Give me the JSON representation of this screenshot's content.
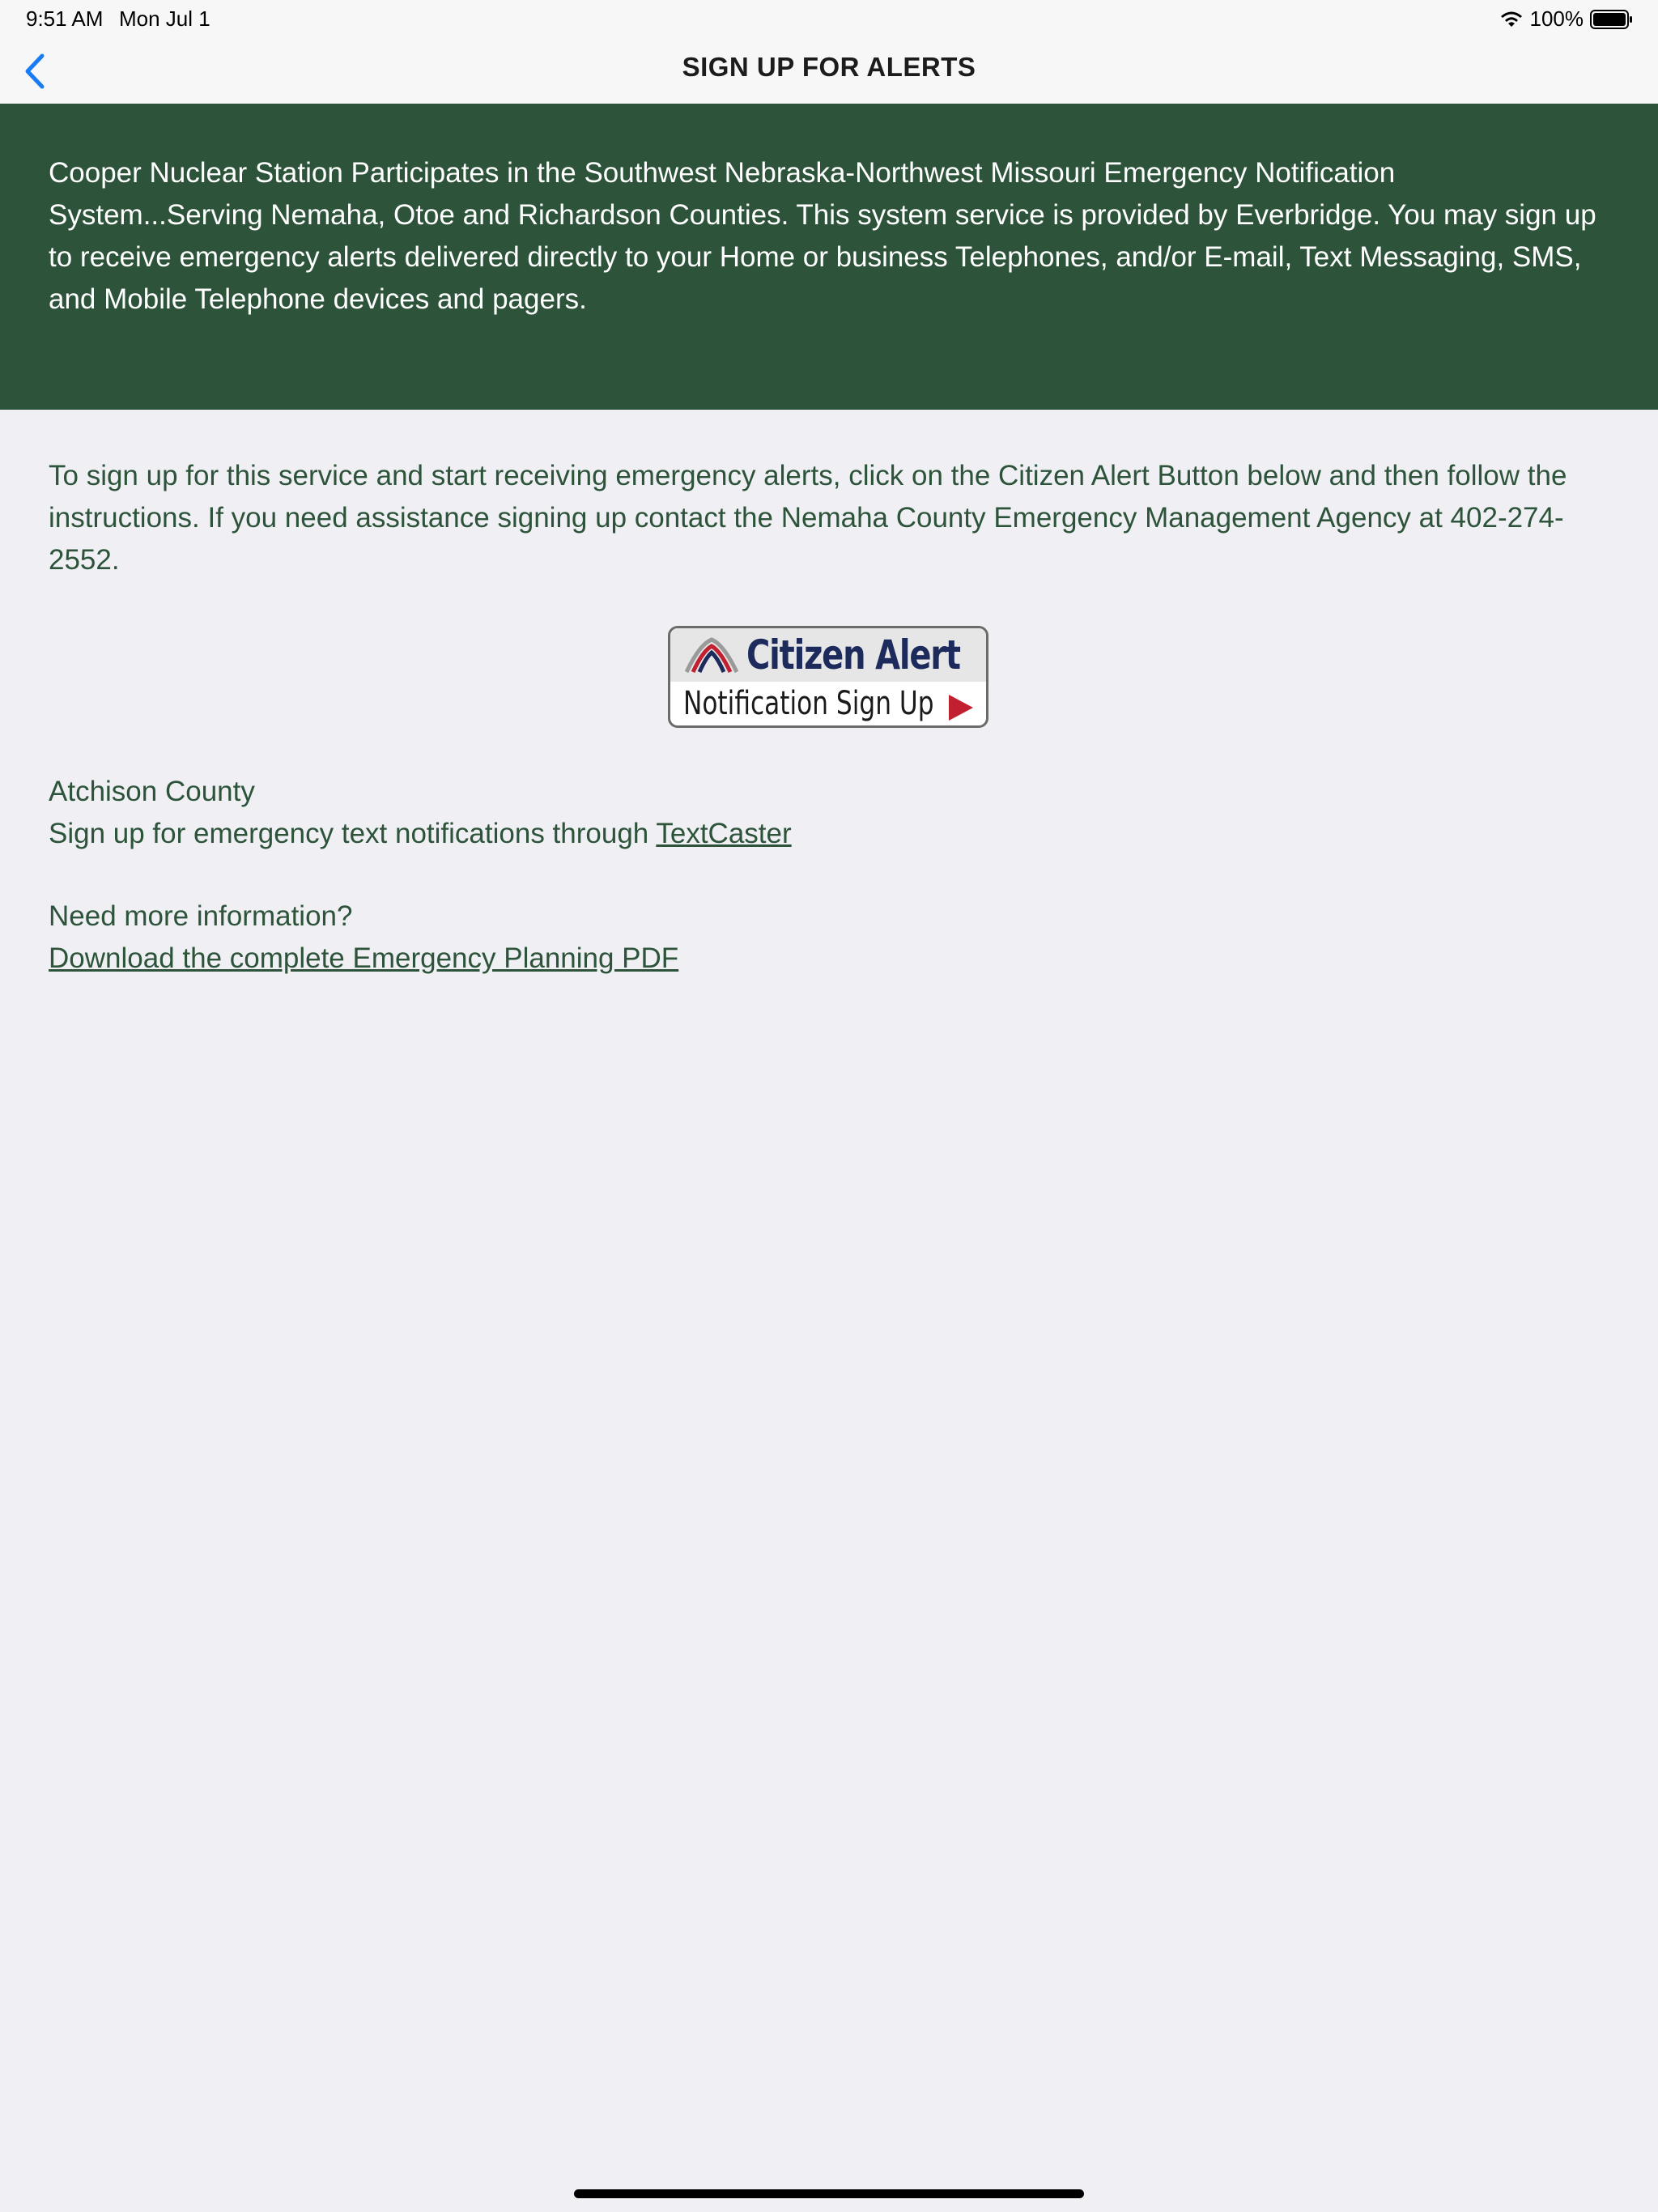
{
  "status_bar": {
    "time": "9:51 AM",
    "date": "Mon Jul 1",
    "battery": "100%"
  },
  "nav": {
    "title": "SIGN UP FOR ALERTS",
    "back_icon": "chevron-left-icon"
  },
  "banner": {
    "text": "Cooper Nuclear Station Participates in the Southwest Nebraska-Northwest Missouri Emergency Notification System...Serving Nemaha, Otoe and Richardson Counties. This system service is provided by Everbridge. You may sign up to receive emergency alerts delivered directly to your Home or business Telephones, and/or E-mail, Text Messaging, SMS, and Mobile Telephone devices and pagers."
  },
  "instructions": {
    "text": "To sign up for this service and start receiving emergency alerts, click on the Citizen Alert Button below and then follow the instructions. If you need assistance signing up contact the Nemaha County Emergency Management Agency at 402-274-2552."
  },
  "citizen_alert": {
    "title": "Citizen Alert",
    "subtitle": "Notification Sign Up"
  },
  "atchison": {
    "heading": "Atchison County",
    "text": "Sign up for emergency text notifications through ",
    "link": "TextCaster"
  },
  "more_info": {
    "heading": "Need more information?",
    "link": "Download the complete Emergency Planning PDF"
  },
  "colors": {
    "banner_bg": "#2d543a",
    "accent_blue": "#1a7cf5",
    "background": "#efeff4"
  }
}
